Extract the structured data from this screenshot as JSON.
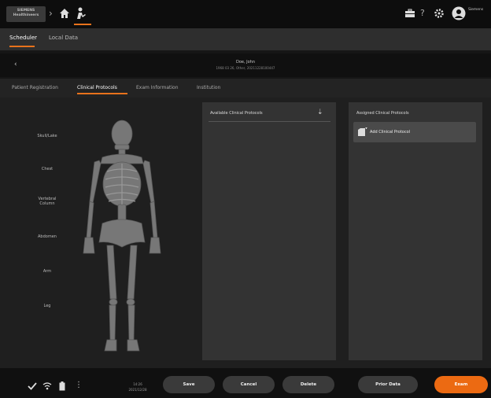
{
  "header": {
    "logo_text": "SIEMENS Healthineers",
    "user_name": "Siemens",
    "icons": [
      "home-icon",
      "patient-icon",
      "toolbox-icon",
      "help-icon",
      "gear-icon",
      "user-avatar-icon"
    ]
  },
  "nav_tabs": [
    {
      "label": "Scheduler",
      "active": true
    },
    {
      "label": "Local Data",
      "active": false
    }
  ],
  "patient": {
    "name": "Doe, John",
    "details": "1968 03 26, Other, 20211228100447"
  },
  "sub_tabs": [
    {
      "label": "Patient Registration",
      "active": false
    },
    {
      "label": "Clinical Protocols",
      "active": true
    },
    {
      "label": "Exam Information",
      "active": false
    },
    {
      "label": "Institution",
      "active": false
    }
  ],
  "body_regions": [
    "Skull/Lake",
    "Chest",
    "Vertebral Column",
    "Abdomen",
    "Arm",
    "Leg"
  ],
  "available_panel": {
    "title": "Available Clinical Protocols"
  },
  "assigned_panel": {
    "title": "Assigned Clinical Protocols",
    "add_label": "Add Clinical Protocol"
  },
  "footer": {
    "time": "14:26",
    "date": "2021/12/28",
    "buttons": {
      "save": "Save",
      "cancel": "Cancel",
      "delete": "Delete",
      "prior": "Prior Data",
      "exam": "Exam"
    }
  },
  "colors": {
    "accent": "#ec6a12",
    "background": "#1f1f1f",
    "panel": "#333333"
  }
}
